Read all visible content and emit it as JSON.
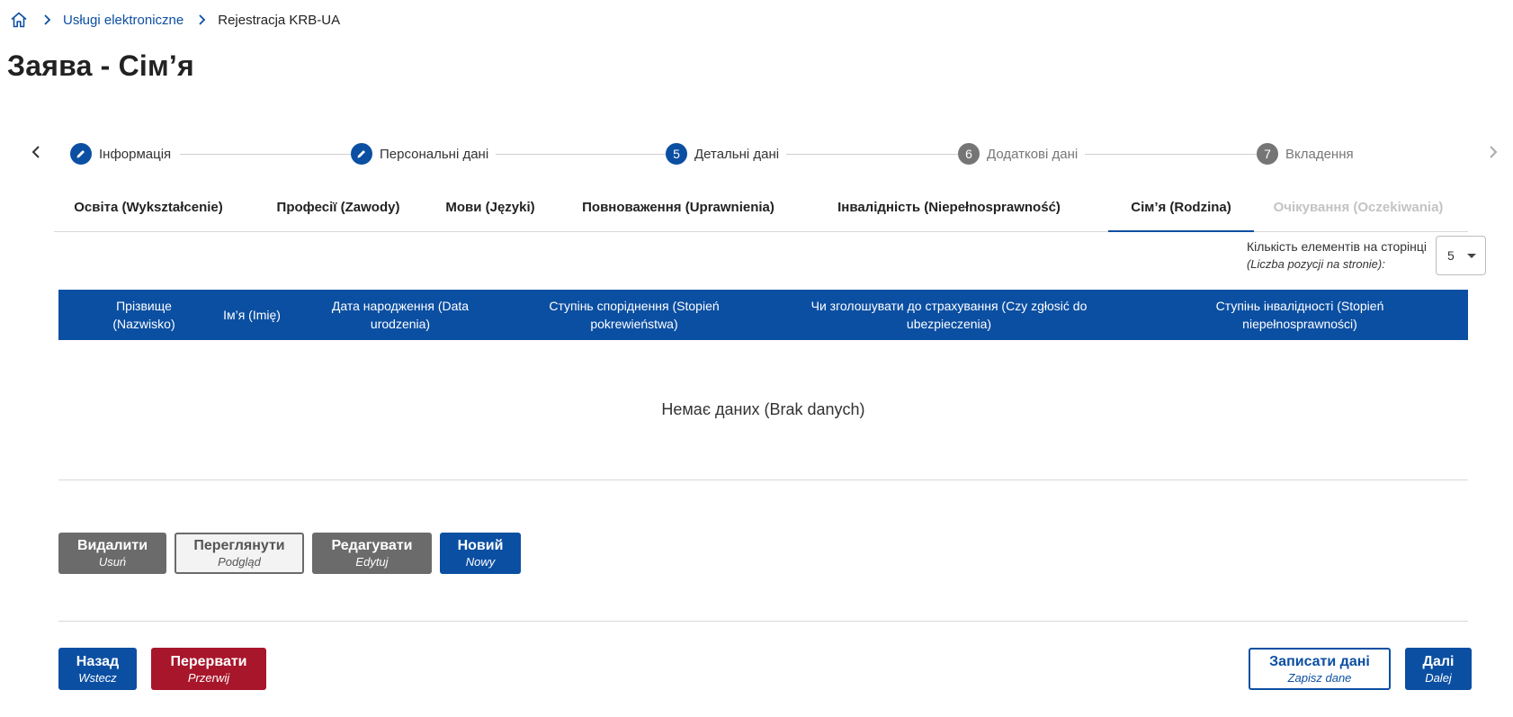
{
  "breadcrumb": {
    "home_icon": "home-icon",
    "items": [
      "Usługi elektroniczne",
      "Rejestracja KRB-UA"
    ]
  },
  "page_title": "Заява - Сім’я",
  "stepper": {
    "steps": [
      {
        "number": "",
        "label": "Інформація",
        "state": "done"
      },
      {
        "number": "",
        "label": "Персональні дані",
        "state": "done"
      },
      {
        "number": "5",
        "label": "Детальні дані",
        "state": "active"
      },
      {
        "number": "6",
        "label": "Додаткові дані",
        "state": "pending"
      },
      {
        "number": "7",
        "label": "Вкладення",
        "state": "pending"
      }
    ]
  },
  "tabs": [
    {
      "label": "Освіта (Wykształcenie)",
      "state": "normal"
    },
    {
      "label": "Професії (Zawody)",
      "state": "normal"
    },
    {
      "label": "Мови (Języki)",
      "state": "normal"
    },
    {
      "label": "Повноваження (Uprawnienia)",
      "state": "normal"
    },
    {
      "label": "Інвалідність (Niepełnosprawność)",
      "state": "normal"
    },
    {
      "label": "Сім’я (Rodzina)",
      "state": "active"
    },
    {
      "label": "Очікування (Oczekiwania)",
      "state": "disabled"
    }
  ],
  "page_size": {
    "label": "Кількість елементів на сторінці",
    "sublabel": "(Liczba pozycji na stronie):",
    "value": "5"
  },
  "table": {
    "columns": [
      "Прізвище (Nazwisko)",
      "Ім’я (Imię)",
      "Дата народження (Data urodzenia)",
      "Ступінь споріднення (Stopień pokrewieństwa)",
      "Чи зголошувати до страхування (Czy zgłosić do ubezpieczenia)",
      "Ступінь інвалідності (Stopień niepełnosprawności)"
    ],
    "empty_text": "Немає даних (Brak danych)"
  },
  "actions": {
    "delete": {
      "main": "Видалити",
      "sub": "Usuń"
    },
    "view": {
      "main": "Переглянути",
      "sub": "Podgląd"
    },
    "edit": {
      "main": "Редагувати",
      "sub": "Edytuj"
    },
    "new": {
      "main": "Новий",
      "sub": "Nowy"
    }
  },
  "footer": {
    "back": {
      "main": "Назад",
      "sub": "Wstecz"
    },
    "abort": {
      "main": "Перервати",
      "sub": "Przerwij"
    },
    "save": {
      "main": "Записати дані",
      "sub": "Zapisz dane"
    },
    "next": {
      "main": "Далі",
      "sub": "Dalej"
    }
  },
  "colors": {
    "primary": "#0b4fa2",
    "danger": "#a8162b",
    "neutral": "#6b6b6b"
  }
}
